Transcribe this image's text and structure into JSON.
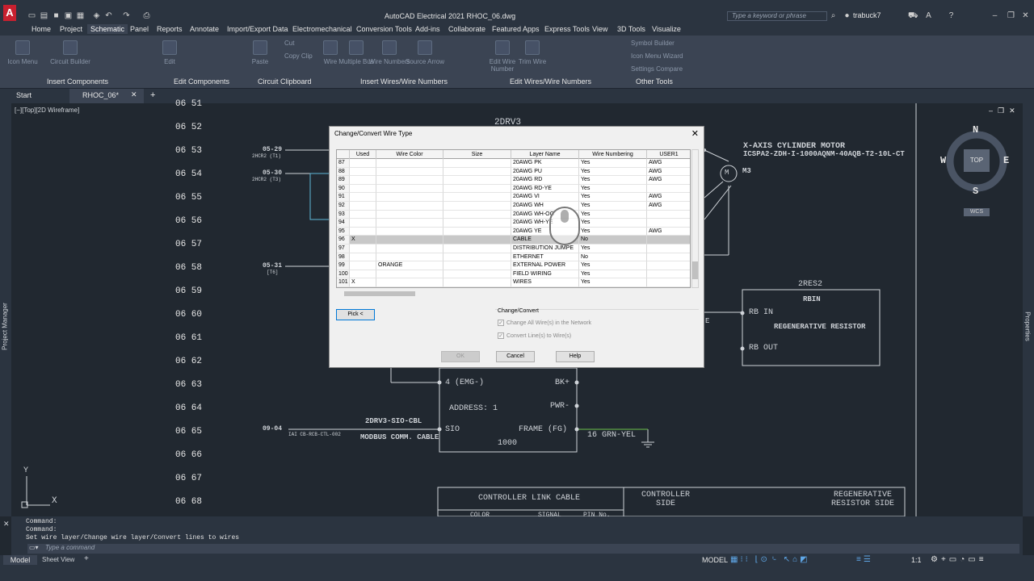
{
  "title_bar": {
    "title": "AutoCAD Electrical 2021   RHOC_06.dwg",
    "search_placeholder": "Type a keyword or phrase",
    "user": "trabuck7",
    "app_letter": "A"
  },
  "menu": [
    "Home",
    "Project",
    "Schematic",
    "Panel",
    "Reports",
    "Annotate",
    "Import/Export Data",
    "Electromechanical",
    "Conversion Tools",
    "Add-ins",
    "Collaborate",
    "Featured Apps",
    "Express Tools",
    "View",
    "3D Tools",
    "Visualize"
  ],
  "menu_active": "Schematic",
  "ribbon": {
    "buttons": [
      "Icon Menu",
      "Circuit Builder",
      "Edit",
      "Paste",
      "Wire",
      "Multiple Bus",
      "Wire Numbers",
      "Source Arrow",
      "Edit Wire Number",
      "Trim Wire"
    ],
    "small": [
      "Cut",
      "Copy Clip",
      "Symbol Builder",
      "Icon Menu Wizard",
      "Settings Compare"
    ],
    "groups": [
      "Insert Components",
      "Edit Components",
      "Circuit Clipboard",
      "Insert Wires/Wire Numbers",
      "Edit Wires/Wire Numbers",
      "Other Tools"
    ]
  },
  "file_tabs": {
    "start": "Start",
    "active": "RHOC_06*"
  },
  "viewport_label": "[−][Top][2D Wireframe]",
  "line_numbers": [
    "06 51",
    "06 52",
    "06 53",
    "06 54",
    "06 55",
    "06 56",
    "06 57",
    "06 58",
    "06 59",
    "06 60",
    "06 61",
    "06 62",
    "06 63",
    "06 64",
    "06 65",
    "06 66",
    "06 67",
    "06 68"
  ],
  "drawing": {
    "top_ref": "2DRV3",
    "motor_title": "X-AXIS CYLINDER MOTOR",
    "motor_part": "ICSPA2-ZDH-I-1000AQNM-40AQB-T2-10L-CT",
    "motor_tag": "M3",
    "motor_symbol": "M",
    "ref_a": "05-29",
    "ref_a_sub": "2HCR2 (T1)",
    "ref_b": "05-30",
    "ref_b_sub": "2HCR2 (T3)",
    "ref_c": "05-31",
    "ref_c_sub": "[T6]",
    "ref_d": "09-04",
    "ref_d_sub": "IAI CB-RCB-CTL-002",
    "res_tag": "2RES2",
    "res_title": "RBIN",
    "res_desc": "REGENERATIVE RESISTOR",
    "rb_in": "RB IN",
    "rb_out": "RB OUT",
    "e_fragment": "E",
    "term_emg": "4 (EMG-)",
    "term_bk": "BK+",
    "term_pwr": "PWR-",
    "address": "ADDRESS: 1",
    "sio": "SIO",
    "frame": "FRAME (FG)",
    "grn": "16 GRN-YEL",
    "num_1000": "1000",
    "cable_tag": "2DRV3-SIO-CBL",
    "cable_desc": "MODBUS COMM. CABLE",
    "tbl_title": "CONTROLLER LINK CABLE",
    "tbl_ctrl": "CONTROLLER SIDE",
    "tbl_regen": "REGENERATIVE RESISTOR SIDE",
    "tbl_color": "COLOR",
    "tbl_signal": "SIGNAL",
    "tbl_pin": "PIN No."
  },
  "viewcube": {
    "n": "N",
    "s": "S",
    "e": "E",
    "w": "W",
    "top": "TOP",
    "wcs": "WCS"
  },
  "side_labels": {
    "left": "Project Manager",
    "right": "Properties"
  },
  "dialog": {
    "title": "Change/Convert Wire Type",
    "columns": [
      "",
      "Used",
      "Wire Color",
      "Size",
      "Layer Name",
      "Wire Numbering",
      "USER1"
    ],
    "rows": [
      {
        "n": "87",
        "used": "",
        "color": "",
        "size": "",
        "layer": "20AWG PK",
        "num": "Yes",
        "user": "AWG"
      },
      {
        "n": "88",
        "used": "",
        "color": "",
        "size": "",
        "layer": "20AWG PU",
        "num": "Yes",
        "user": "AWG"
      },
      {
        "n": "89",
        "used": "",
        "color": "",
        "size": "",
        "layer": "20AWG RD",
        "num": "Yes",
        "user": "AWG"
      },
      {
        "n": "90",
        "used": "",
        "color": "",
        "size": "",
        "layer": "20AWG RD-YE",
        "num": "Yes",
        "user": ""
      },
      {
        "n": "91",
        "used": "",
        "color": "",
        "size": "",
        "layer": "20AWG VI",
        "num": "Yes",
        "user": "AWG"
      },
      {
        "n": "92",
        "used": "",
        "color": "",
        "size": "",
        "layer": "20AWG WH",
        "num": "Yes",
        "user": "AWG"
      },
      {
        "n": "93",
        "used": "",
        "color": "",
        "size": "",
        "layer": "20AWG WH-OG",
        "num": "Yes",
        "user": ""
      },
      {
        "n": "94",
        "used": "",
        "color": "",
        "size": "",
        "layer": "20AWG WH-YE",
        "num": "Yes",
        "user": ""
      },
      {
        "n": "95",
        "used": "",
        "color": "",
        "size": "",
        "layer": "20AWG YE",
        "num": "Yes",
        "user": "AWG"
      },
      {
        "n": "96",
        "used": "X",
        "color": "",
        "size": "",
        "layer": "CABLE",
        "num": "No",
        "user": ""
      },
      {
        "n": "97",
        "used": "",
        "color": "",
        "size": "",
        "layer": "DISTRIBUTION JUMPE",
        "num": "Yes",
        "user": ""
      },
      {
        "n": "98",
        "used": "",
        "color": "",
        "size": "",
        "layer": "ETHERNET",
        "num": "No",
        "user": ""
      },
      {
        "n": "99",
        "used": "",
        "color": "ORANGE",
        "size": "",
        "layer": "EXTERNAL POWER",
        "num": "Yes",
        "user": ""
      },
      {
        "n": "100",
        "used": "",
        "color": "",
        "size": "",
        "layer": "FIELD WIRING",
        "num": "Yes",
        "user": ""
      },
      {
        "n": "101",
        "used": "X",
        "color": "",
        "size": "",
        "layer": "WIRES",
        "num": "Yes",
        "user": ""
      }
    ],
    "pick": "Pick <",
    "group_label": "Change/Convert",
    "cb1": "Change All Wire(s) in the Network",
    "cb2": "Convert Line(s) to Wire(s)",
    "ok": "OK",
    "cancel": "Cancel",
    "help": "Help"
  },
  "command": {
    "line1": "Command:",
    "line2": "Command:",
    "line3": "Set wire layer/Change wire layer/Convert lines to wires",
    "placeholder": "Type a command"
  },
  "layout_tabs": [
    "Model",
    "Sheet View"
  ],
  "status": {
    "model": "MODEL",
    "scale": "1:1"
  }
}
